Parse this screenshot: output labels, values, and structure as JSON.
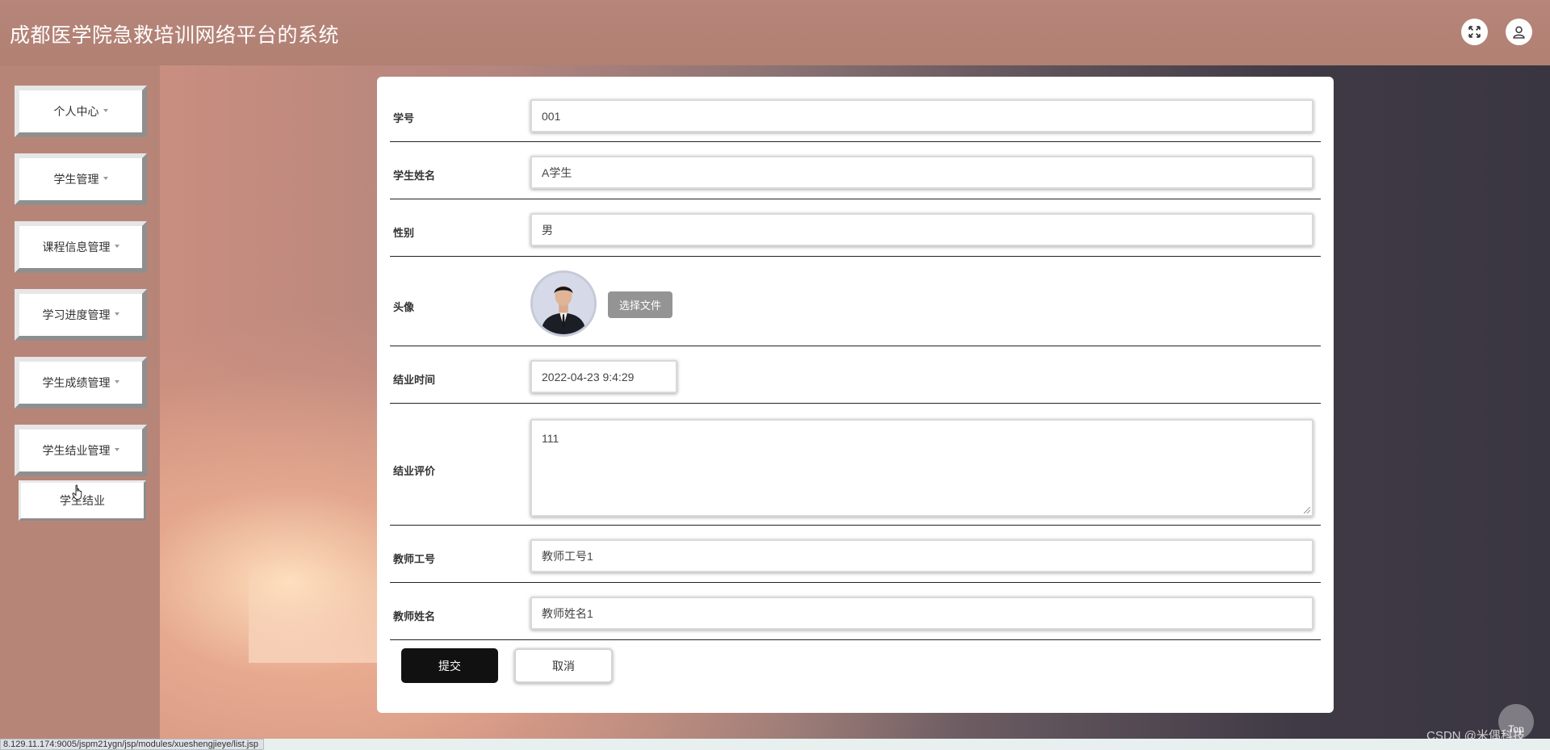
{
  "header": {
    "title": "成都医学院急救培训网络平台的系统",
    "fullscreen_icon": "fullscreen-icon",
    "user_icon": "user-icon"
  },
  "sidebar": {
    "items": [
      {
        "label": "个人中心"
      },
      {
        "label": "学生管理"
      },
      {
        "label": "课程信息管理"
      },
      {
        "label": "学习进度管理"
      },
      {
        "label": "学生成绩管理"
      },
      {
        "label": "学生结业管理"
      }
    ],
    "sub_items": [
      {
        "label": "学生结业"
      }
    ]
  },
  "form": {
    "fields": {
      "student_id": {
        "label": "学号",
        "value": "001"
      },
      "student_name": {
        "label": "学生姓名",
        "value": "A学生"
      },
      "gender": {
        "label": "性别",
        "value": "男"
      },
      "avatar": {
        "label": "头像",
        "button": "选择文件"
      },
      "graduation_time": {
        "label": "结业时间",
        "value": "2022-04-23 9:4:29"
      },
      "graduation_review": {
        "label": "结业评价",
        "value": "111"
      },
      "teacher_id": {
        "label": "教师工号",
        "value": "教师工号1"
      },
      "teacher_name": {
        "label": "教师姓名",
        "value": "教师姓名1"
      }
    },
    "submit_label": "提交",
    "cancel_label": "取消"
  },
  "footer": {
    "top_label": "Top",
    "watermark": "CSDN @米偶科技",
    "status_url": "8.129.11.174:9005/jspm21ygn/jsp/modules/xueshengjieye/list.jsp"
  }
}
